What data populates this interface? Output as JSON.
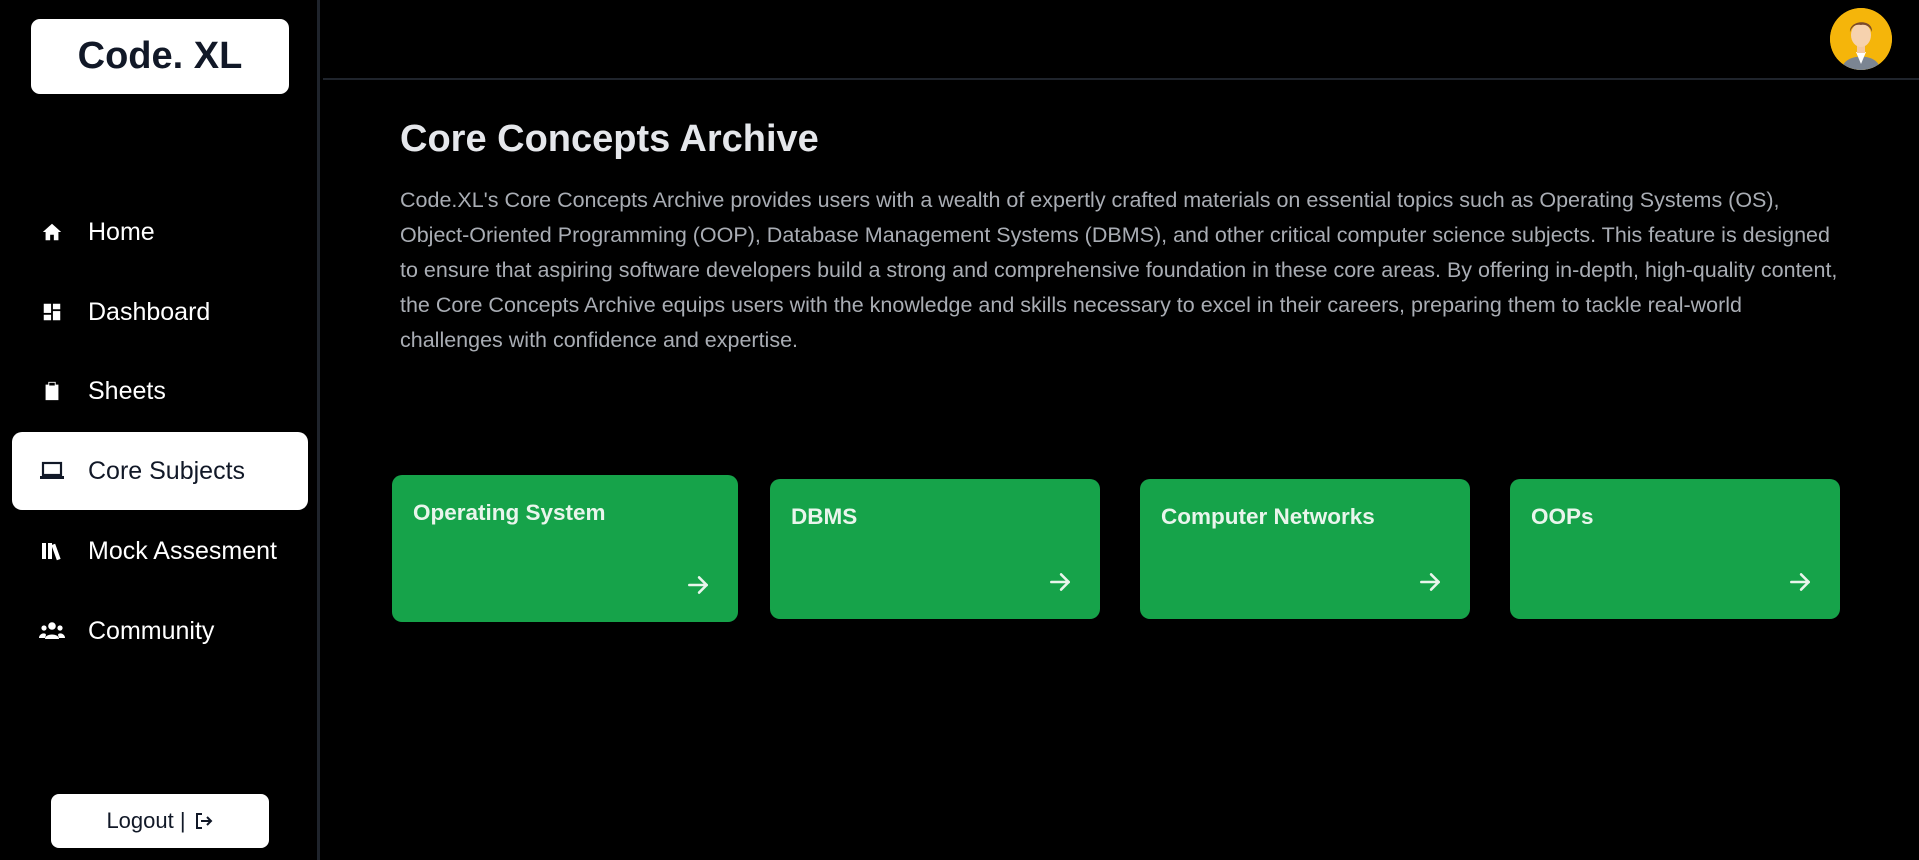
{
  "app": {
    "logo": "Code. XL"
  },
  "sidebar": {
    "items": [
      {
        "label": "Home",
        "icon": "home-icon"
      },
      {
        "label": "Dashboard",
        "icon": "dashboard-icon"
      },
      {
        "label": "Sheets",
        "icon": "clipboard-icon"
      },
      {
        "label": "Core Subjects",
        "icon": "laptop-icon",
        "active": true
      },
      {
        "label": "Mock Assesment",
        "icon": "books-icon"
      },
      {
        "label": "Community",
        "icon": "users-icon"
      }
    ],
    "logout_label": "Logout |"
  },
  "header": {
    "avatar": "user-avatar"
  },
  "main": {
    "title": "Core Concepts Archive",
    "description": "Code.XL's Core Concepts Archive provides users with a wealth of expertly crafted materials on essential topics such as Operating Systems (OS), Object-Oriented Programming (OOP), Database Management Systems (DBMS), and other critical computer science subjects. This feature is designed to ensure that aspiring software developers build a strong and comprehensive foundation in these core areas. By offering in-depth, high-quality content, the Core Concepts Archive equips users with the knowledge and skills necessary to excel in their careers, preparing them to tackle real-world challenges with confidence and expertise.",
    "cards": [
      {
        "title": "Operating System",
        "icon": "arrow-right-icon"
      },
      {
        "title": "DBMS",
        "icon": "arrow-right-icon"
      },
      {
        "title": "Computer Networks",
        "icon": "arrow-right-icon"
      },
      {
        "title": "OOPs",
        "icon": "arrow-right-icon"
      }
    ]
  },
  "colors": {
    "background": "#000000",
    "card_green": "#16a34a",
    "sidebar_active": "#ffffff",
    "avatar_bg": "#f5b50a"
  }
}
